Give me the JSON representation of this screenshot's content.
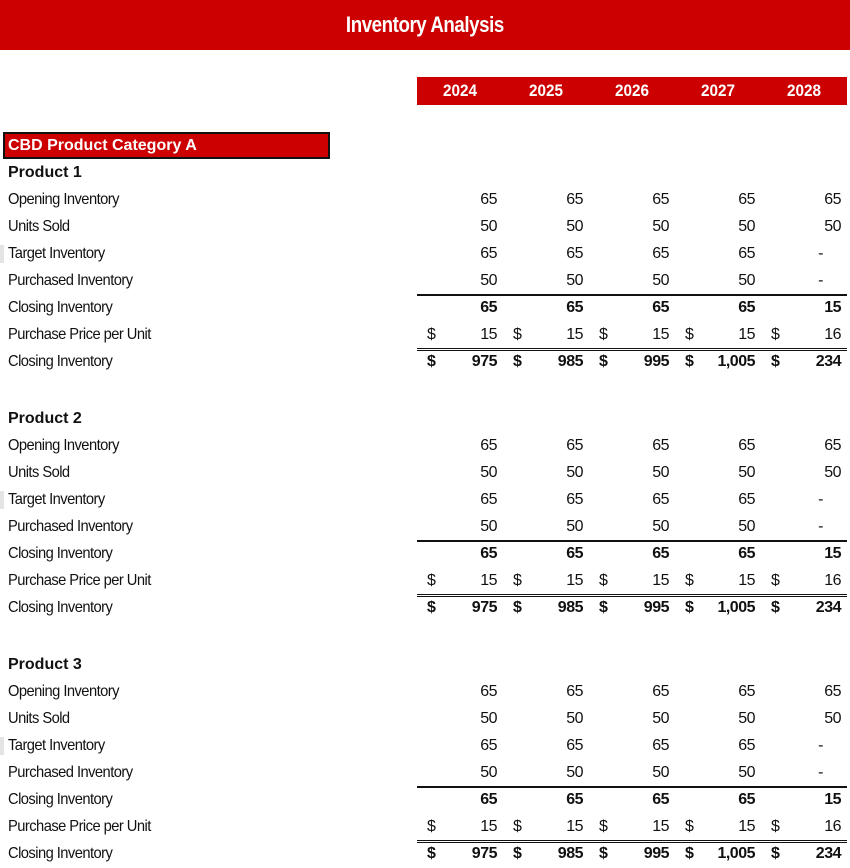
{
  "header": {
    "title": "Inventory Analysis"
  },
  "years": [
    "2024",
    "2025",
    "2026",
    "2027",
    "2028"
  ],
  "category": {
    "label": "CBD Product Category A"
  },
  "products": [
    {
      "name": "Product 1",
      "rows": [
        {
          "label": "Opening Inventory",
          "values": [
            "65",
            "65",
            "65",
            "65",
            "65"
          ]
        },
        {
          "label": "Units Sold",
          "values": [
            "50",
            "50",
            "50",
            "50",
            "50"
          ]
        },
        {
          "label": "Target Inventory",
          "values": [
            "65",
            "65",
            "65",
            "65",
            "-"
          ]
        },
        {
          "label": "Purchased Inventory",
          "values": [
            "50",
            "50",
            "50",
            "50",
            "-"
          ]
        },
        {
          "label": "Closing Inventory",
          "values": [
            "65",
            "65",
            "65",
            "65",
            "15"
          ]
        },
        {
          "label": "Purchase Price per Unit",
          "currency": "$",
          "values": [
            "15",
            "15",
            "15",
            "15",
            "16"
          ]
        },
        {
          "label": "Closing Inventory",
          "currency": "$",
          "values": [
            "975",
            "985",
            "995",
            "1,005",
            "234"
          ]
        }
      ]
    },
    {
      "name": "Product 2",
      "rows": [
        {
          "label": "Opening Inventory",
          "values": [
            "65",
            "65",
            "65",
            "65",
            "65"
          ]
        },
        {
          "label": "Units Sold",
          "values": [
            "50",
            "50",
            "50",
            "50",
            "50"
          ]
        },
        {
          "label": "Target Inventory",
          "values": [
            "65",
            "65",
            "65",
            "65",
            "-"
          ]
        },
        {
          "label": "Purchased Inventory",
          "values": [
            "50",
            "50",
            "50",
            "50",
            "-"
          ]
        },
        {
          "label": "Closing Inventory",
          "values": [
            "65",
            "65",
            "65",
            "65",
            "15"
          ]
        },
        {
          "label": "Purchase Price per Unit",
          "currency": "$",
          "values": [
            "15",
            "15",
            "15",
            "15",
            "16"
          ]
        },
        {
          "label": "Closing Inventory",
          "currency": "$",
          "values": [
            "975",
            "985",
            "995",
            "1,005",
            "234"
          ]
        }
      ]
    },
    {
      "name": "Product 3",
      "rows": [
        {
          "label": "Opening Inventory",
          "values": [
            "65",
            "65",
            "65",
            "65",
            "65"
          ]
        },
        {
          "label": "Units Sold",
          "values": [
            "50",
            "50",
            "50",
            "50",
            "50"
          ]
        },
        {
          "label": "Target Inventory",
          "values": [
            "65",
            "65",
            "65",
            "65",
            "-"
          ]
        },
        {
          "label": "Purchased Inventory",
          "values": [
            "50",
            "50",
            "50",
            "50",
            "-"
          ]
        },
        {
          "label": "Closing Inventory",
          "values": [
            "65",
            "65",
            "65",
            "65",
            "15"
          ]
        },
        {
          "label": "Purchase Price per Unit",
          "currency": "$",
          "values": [
            "15",
            "15",
            "15",
            "15",
            "16"
          ]
        },
        {
          "label": "Closing Inventory",
          "currency": "$",
          "values": [
            "975",
            "985",
            "995",
            "1,005",
            "234"
          ]
        }
      ]
    }
  ]
}
